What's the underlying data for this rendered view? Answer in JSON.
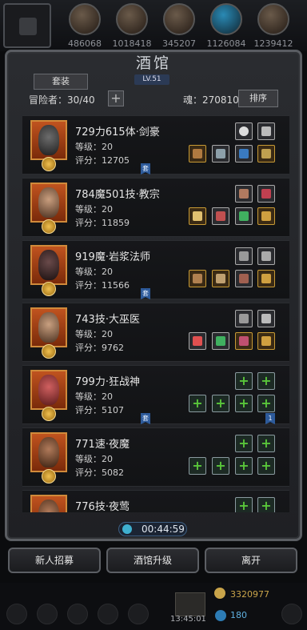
{
  "resources": [
    "486068",
    "1018418",
    "345207",
    "1126084",
    "1239412"
  ],
  "tavern": {
    "title": "酒馆",
    "level": "LV.51",
    "set_label": "套装",
    "adventurers_label": "冒险者：30/40",
    "soul_label": "魂：270810",
    "sort_label": "排序"
  },
  "heroes": [
    {
      "name": "729力615体·剑豪",
      "level": "等级：20",
      "score": "评分：12705"
    },
    {
      "name": "784魔501技·教宗",
      "level": "等级：20",
      "score": "评分：11859"
    },
    {
      "name": "919魔·岩浆法师",
      "level": "等级：20",
      "score": "评分：11566"
    },
    {
      "name": "743技·大巫医",
      "level": "等级：20",
      "score": "评分：9762"
    },
    {
      "name": "799力·狂战神",
      "level": "等级：20",
      "score": "评分：5107"
    },
    {
      "name": "771速·夜魔",
      "level": "等级：20",
      "score": "评分：5082"
    },
    {
      "name": "776技·夜莺",
      "level": "",
      "score": ""
    }
  ],
  "badges": {
    "set": "套",
    "count": "1"
  },
  "timer": "00:44:59",
  "buttons": {
    "recruit": "新人招募",
    "upgrade": "酒馆升级",
    "leave": "离开"
  },
  "hud": {
    "gold": "3320977",
    "gems": "180",
    "time": "13:45:01"
  }
}
